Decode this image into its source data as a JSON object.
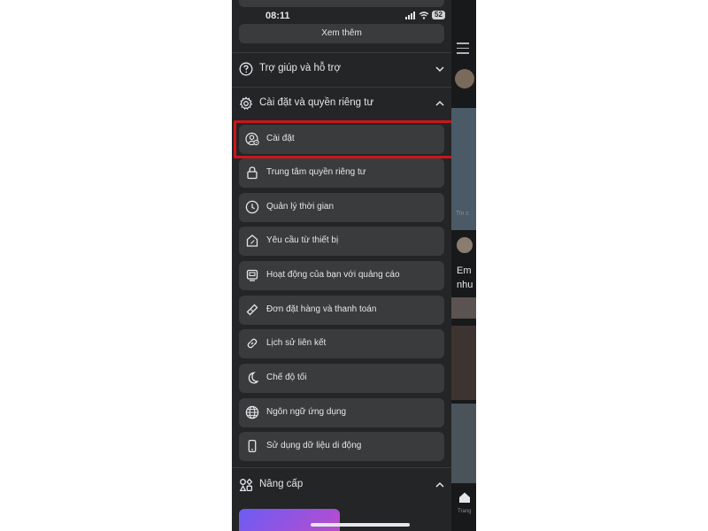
{
  "status_bar": {
    "time": "08:11",
    "battery": "52"
  },
  "menu": {
    "see_more_label": "Xem thêm",
    "help": {
      "label": "Trợ giúp và hỗ trợ"
    },
    "settings_privacy": {
      "label": "Cài đặt và quyền riêng tư",
      "items": [
        {
          "label": "Cài đặt",
          "icon": "user-gear-icon"
        },
        {
          "label": "Trung tâm quyền riêng tư",
          "icon": "lock-icon"
        },
        {
          "label": "Quản lý thời gian",
          "icon": "clock-icon"
        },
        {
          "label": "Yêu cầu từ thiết bị",
          "icon": "device-request-icon"
        },
        {
          "label": "Hoạt động của bạn với quảng cáo",
          "icon": "ad-activity-icon"
        },
        {
          "label": "Đơn đặt hàng và thanh toán",
          "icon": "tag-icon"
        },
        {
          "label": "Lịch sử liên kết",
          "icon": "link-icon"
        },
        {
          "label": "Chế độ tối",
          "icon": "moon-icon"
        },
        {
          "label": "Ngôn ngữ ứng dụng",
          "icon": "globe-icon"
        },
        {
          "label": "Sử dụng dữ liệu di động",
          "icon": "phone-icon"
        }
      ]
    },
    "upgrade": {
      "label": "Nâng cấp"
    }
  },
  "feed_peek": {
    "caption": "Tin c",
    "post_text_line1": "Em",
    "post_text_line2": "nhu",
    "tab_label": "Trang"
  },
  "colors": {
    "menu_bg": "#242526",
    "item_bg": "#3a3b3c",
    "text": "#e4e6eb",
    "highlight_border": "#c9161b"
  }
}
